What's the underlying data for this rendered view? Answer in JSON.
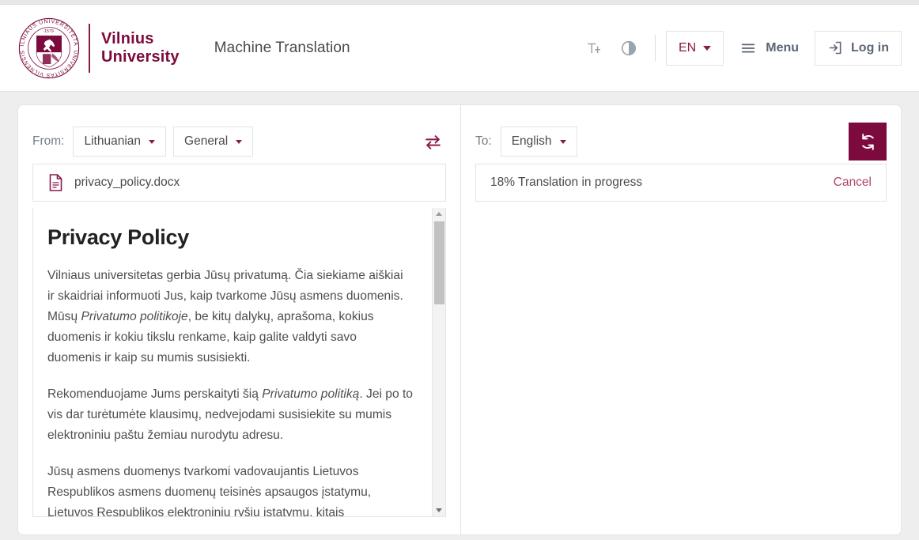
{
  "header": {
    "wordmark_line1": "Vilnius",
    "wordmark_line2": "University",
    "app_title": "Machine Translation",
    "seal_outer_top": "VILNIAUS UNIVERSITETAS",
    "seal_outer_bottom": "UNIVERSITAS VILNENSIS",
    "seal_year": "1579",
    "text_size_icon": "text-size-icon",
    "contrast_icon": "contrast-icon",
    "language_code": "EN",
    "menu_label": "Menu",
    "login_label": "Log in",
    "brand_color": "#7d0a3c"
  },
  "source": {
    "from_label": "From:",
    "language": "Lithuanian",
    "domain": "General",
    "swap_icon": "swap-arrows-icon",
    "file_icon": "document-icon",
    "file_name": "privacy_policy.docx",
    "document": {
      "title": "Privacy Policy",
      "paragraphs": [
        {
          "parts": [
            {
              "text": "Vilniaus universitetas gerbia Jūsų privatumą. Čia siekiame aiškiai ir skaidriai informuoti Jus, kaip tvarkome Jūsų asmens duomenis. Mūsų ",
              "italic": false
            },
            {
              "text": "Privatumo politikoje",
              "italic": true
            },
            {
              "text": ", be kitų dalykų, aprašoma, kokius duomenis ir kokiu tikslu renkame, kaip galite valdyti savo duomenis ir kaip su mumis susisiekti.",
              "italic": false
            }
          ]
        },
        {
          "parts": [
            {
              "text": "Rekomenduojame Jums perskaityti šią ",
              "italic": false
            },
            {
              "text": "Privatumo politiką",
              "italic": true
            },
            {
              "text": ". Jei po to vis dar turėtumėte klausimų, nedvejodami susisiekite su mumis elektroniniu paštu žemiau nurodytu adresu.",
              "italic": false
            }
          ]
        },
        {
          "parts": [
            {
              "text": "Jūsų asmens duomenys tvarkomi vadovaujantis Lietuvos Respublikos asmens duomenų teisinės apsaugos įstatymu, Lietuvos Respublikos elektroninių ryšių įstatymu, kitais",
              "italic": false
            }
          ]
        }
      ]
    }
  },
  "target": {
    "to_label": "To:",
    "language": "English",
    "retranslate_icon": "refresh-icon",
    "progress_text": "18% Translation in progress",
    "progress_percent": 18,
    "cancel_label": "Cancel"
  }
}
